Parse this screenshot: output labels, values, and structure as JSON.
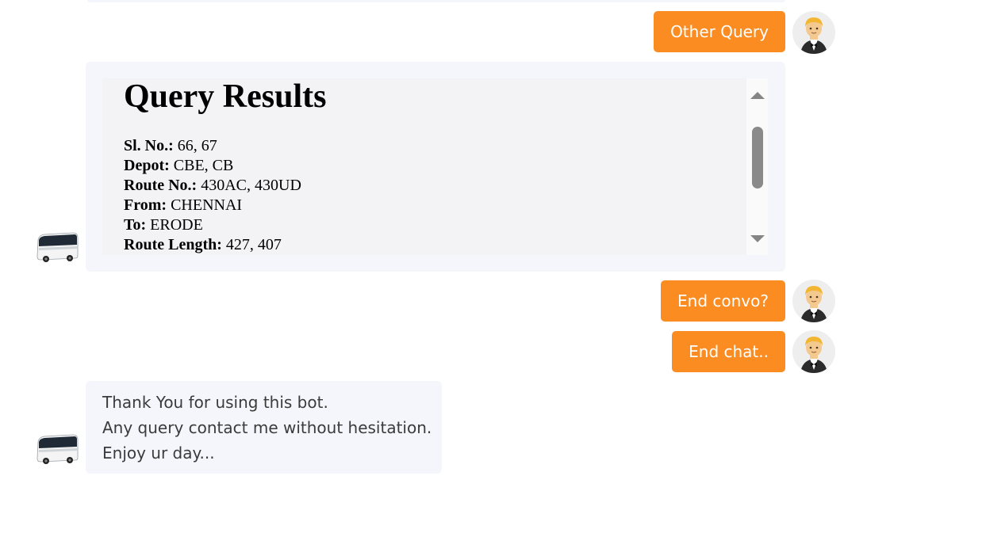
{
  "messages": {
    "user_1": "Other Query",
    "user_2": "End convo?",
    "user_3": "End chat..",
    "results": {
      "title": "Query Results",
      "rows": [
        {
          "label": "Sl. No.:",
          "value": " 66, 67"
        },
        {
          "label": "Depot:",
          "value": " CBE, CB"
        },
        {
          "label": "Route No.:",
          "value": " 430AC, 430UD"
        },
        {
          "label": "From:",
          "value": " CHENNAI"
        },
        {
          "label": "To:",
          "value": " ERODE"
        },
        {
          "label": "Route Length:",
          "value": " 427, 407"
        }
      ]
    },
    "thanks": {
      "line_1": "Thank You for using this bot.",
      "line_2": "Any query contact me without hesitation.",
      "line_3": "Enjoy ur day..."
    }
  },
  "icons": {
    "user_avatar": "man-in-tuxedo-icon",
    "bot_avatar": "bus-icon"
  },
  "colors": {
    "user_bubble": "#fa8c22",
    "bot_bubble": "#f4f6fb"
  }
}
